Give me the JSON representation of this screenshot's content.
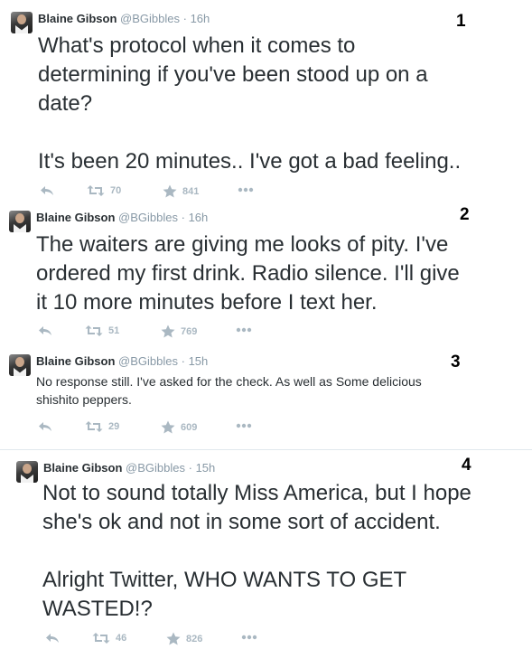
{
  "tweets": [
    {
      "author_name": "Blaine Gibson",
      "handle": "@BGibbles",
      "time": "16h",
      "number": "1",
      "text": "What's protocol when it comes to\ndetermining if you've been stood up on a\ndate?\n\nIt's been 20 minutes.. I've got a bad feeling..",
      "retweets": "70",
      "favorites": "841"
    },
    {
      "author_name": "Blaine Gibson",
      "handle": "@BGibbles",
      "time": "16h",
      "number": "2",
      "text": "The waiters are giving me looks of pity. I've\nordered my first drink. Radio silence. I'll give\nit 10 more minutes before I text her.",
      "retweets": "51",
      "favorites": "769"
    },
    {
      "author_name": "Blaine Gibson",
      "handle": "@BGibbles",
      "time": "15h",
      "number": "3",
      "text": "No response still. I've asked for the check. As well as Some delicious\nshishito peppers.",
      "retweets": "29",
      "favorites": "609"
    },
    {
      "author_name": "Blaine Gibson",
      "handle": "@BGibbles",
      "time": "15h",
      "number": "4",
      "text": "Not to sound totally Miss America, but I hope\nshe's ok and not in some sort of accident.\n\nAlright Twitter, WHO WANTS TO GET\nWASTED!?",
      "retweets": "46",
      "favorites": "826"
    }
  ],
  "separator": "·",
  "icons": [
    "reply-icon",
    "retweet-icon",
    "favorite-star-icon",
    "more-icon"
  ],
  "colors": {
    "text": "#292f33",
    "meta": "#8899a6",
    "action": "#aab8c2"
  }
}
